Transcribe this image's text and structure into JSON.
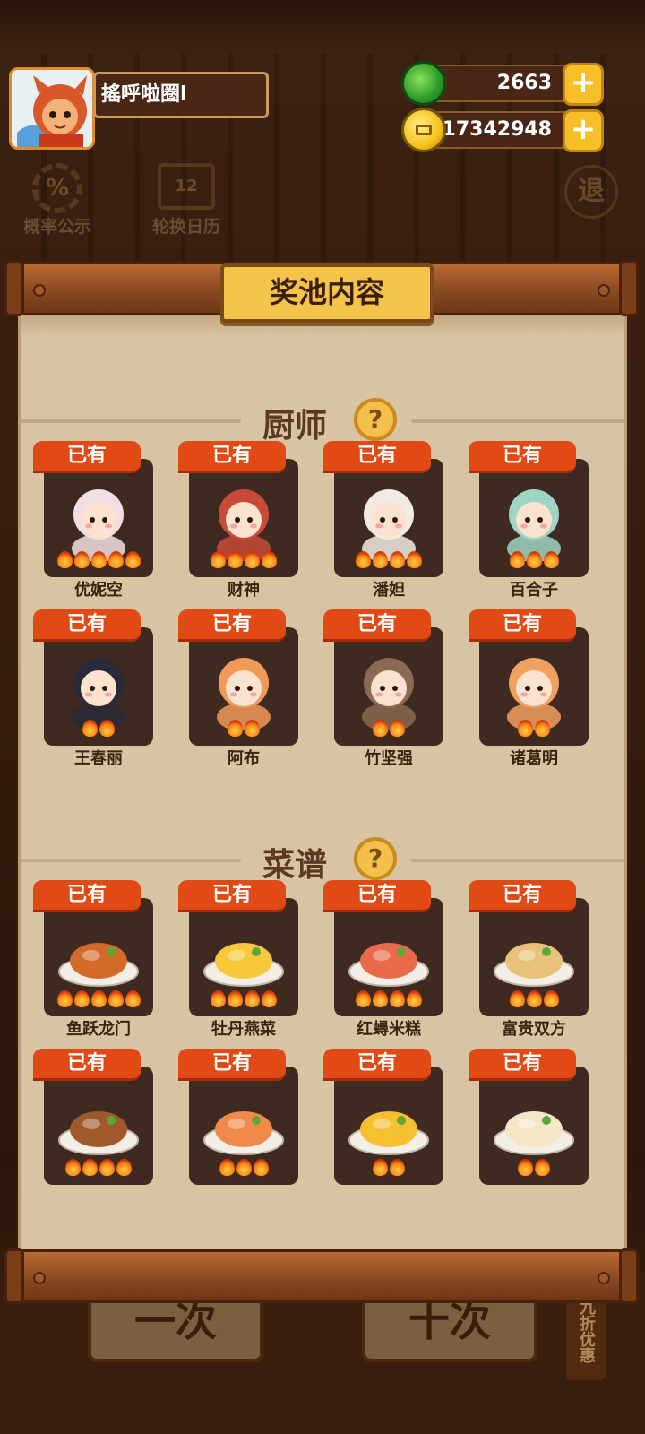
{
  "header": {
    "player_name": "搖呼啦圈l",
    "jade_count": "2663",
    "coin_count": "17342948",
    "probability_label": "概率公示",
    "calendar_label": "轮换日历",
    "exit_label": "退"
  },
  "background": {
    "single_draw_label": "一次",
    "ten_draw_label": "十次",
    "discount_label": "九折优惠"
  },
  "modal": {
    "title": "奖池内容"
  },
  "sections": [
    {
      "title": "厨师",
      "items": [
        {
          "status": "已有",
          "name": "优妮空",
          "stars": 5,
          "color": "#f3dfe3"
        },
        {
          "status": "已有",
          "name": "财神",
          "stars": 4,
          "color": "#c94a3a"
        },
        {
          "status": "已有",
          "name": "潘妲",
          "stars": 4,
          "color": "#f0ece4"
        },
        {
          "status": "已有",
          "name": "百合子",
          "stars": 3,
          "color": "#9fd4c6"
        },
        {
          "status": "已有",
          "name": "王春丽",
          "stars": 2,
          "color": "#2a2a3a"
        },
        {
          "status": "已有",
          "name": "阿布",
          "stars": 2,
          "color": "#f09a5a"
        },
        {
          "status": "已有",
          "name": "竹坚强",
          "stars": 2,
          "color": "#8a6a52"
        },
        {
          "status": "已有",
          "name": "诸葛明",
          "stars": 2,
          "color": "#f0a060"
        }
      ]
    },
    {
      "title": "菜谱",
      "items": [
        {
          "status": "已有",
          "name": "鱼跃龙门",
          "stars": 5,
          "color": "#d46a2a"
        },
        {
          "status": "已有",
          "name": "牡丹燕菜",
          "stars": 4,
          "color": "#f6c83a"
        },
        {
          "status": "已有",
          "name": "红蟳米糕",
          "stars": 4,
          "color": "#e86a4a"
        },
        {
          "status": "已有",
          "name": "富贵双方",
          "stars": 3,
          "color": "#e8c27a"
        },
        {
          "status": "已有",
          "name": "",
          "stars": 4,
          "color": "#a05a2a"
        },
        {
          "status": "已有",
          "name": "",
          "stars": 3,
          "color": "#f08a4a"
        },
        {
          "status": "已有",
          "name": "",
          "stars": 2,
          "color": "#f6c030"
        },
        {
          "status": "已有",
          "name": "",
          "stars": 2,
          "color": "#f6e6c8"
        }
      ]
    }
  ]
}
